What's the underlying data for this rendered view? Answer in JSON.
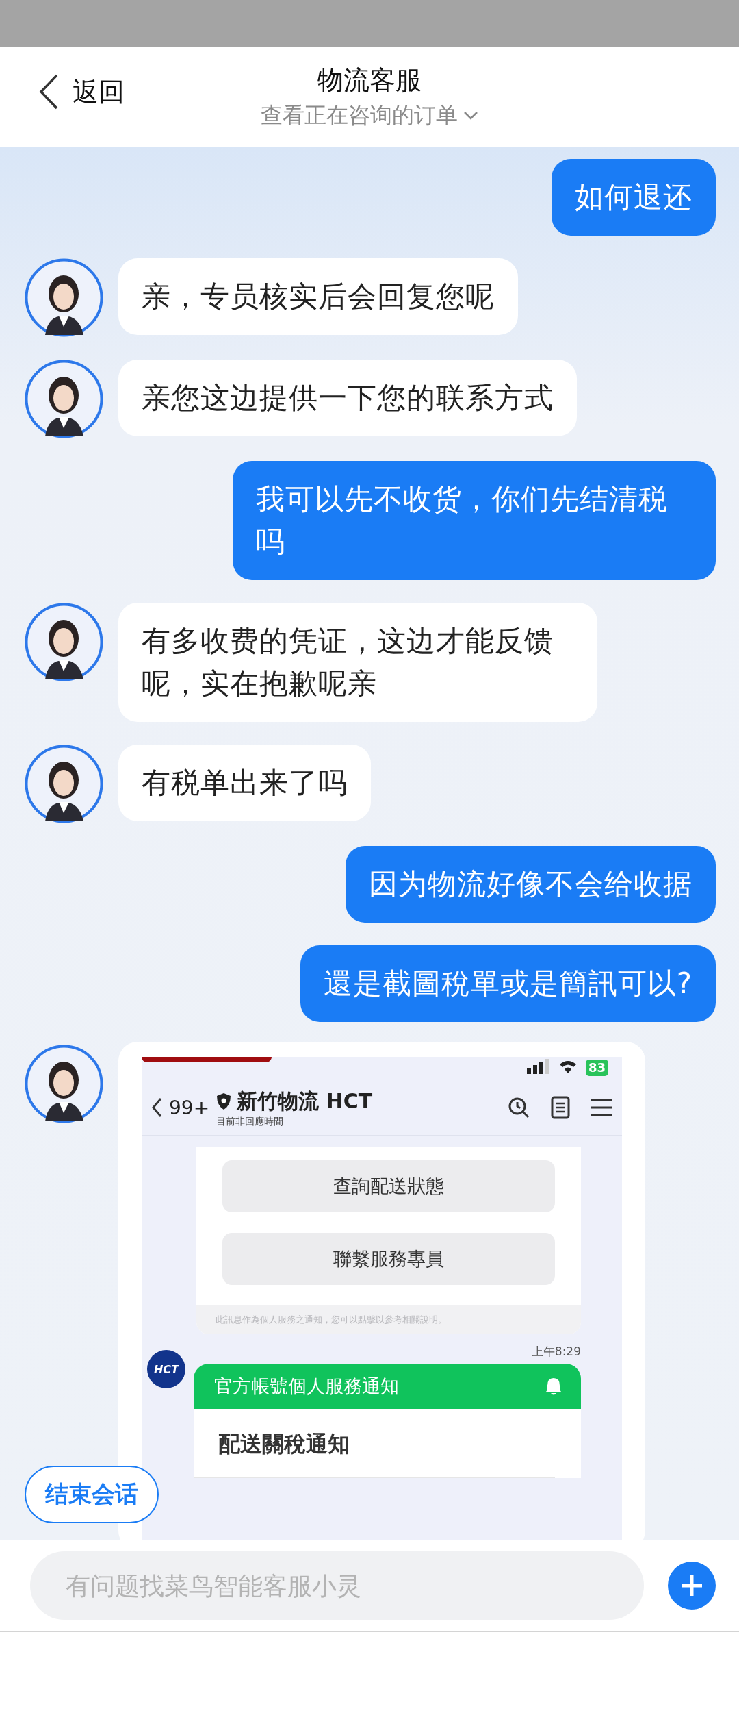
{
  "header": {
    "back_label": "返回",
    "title": "物流客服",
    "subtitle": "查看正在咨询的订单"
  },
  "messages": [
    {
      "kind": "sent",
      "text": "如何退还"
    },
    {
      "kind": "received",
      "text": "亲，专员核实后会回复您呢"
    },
    {
      "kind": "received",
      "text": "亲您这边提供一下您的联系方式"
    },
    {
      "kind": "sent",
      "text": "我可以先不收货，你们先结清税吗"
    },
    {
      "kind": "received",
      "text": "有多收费的凭证，这边才能反馈呢，实在抱歉呢亲"
    },
    {
      "kind": "received",
      "text": "有税单出来了吗"
    },
    {
      "kind": "sent",
      "text": "因为物流好像不会给收据"
    },
    {
      "kind": "sent",
      "text": "還是截圖稅單或是簡訊可以?"
    },
    {
      "kind": "received_image",
      "screenshot": {
        "battery": "83",
        "back_count": "99+",
        "title": "新竹物流 HCT",
        "subtitle": "目前非回應時間",
        "buttons": [
          "查詢配送狀態",
          "聯繫服務專員"
        ],
        "note": "此訊息作為個人服務之通知，您可以點擊以參考相關說明。",
        "time": "上午8:29",
        "logo": "HCT",
        "card_header": "官方帳號個人服務通知",
        "card_title": "配送關稅通知"
      }
    }
  ],
  "end_button": "结束会话",
  "input": {
    "placeholder": "有问题找菜鸟智能客服小灵"
  }
}
